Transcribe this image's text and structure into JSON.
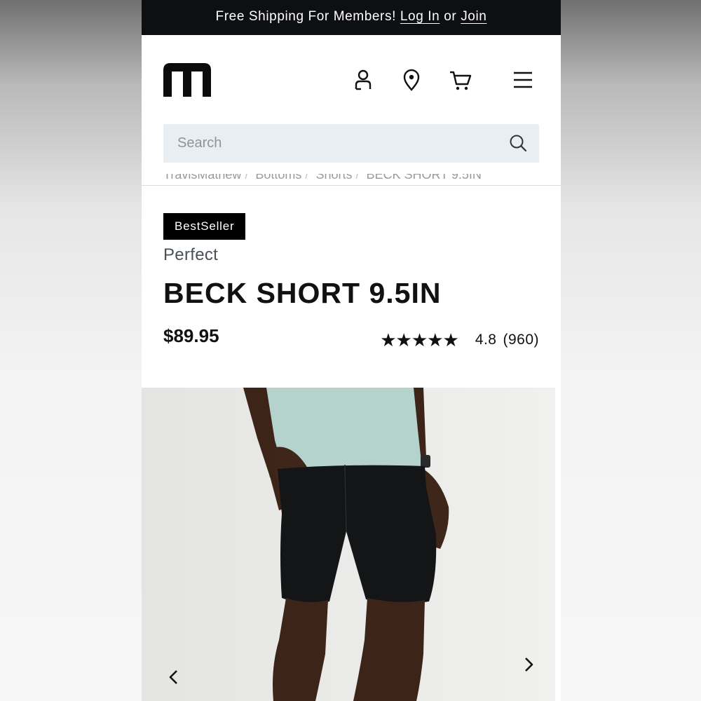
{
  "promo": {
    "text": "Free Shipping For Members!",
    "login_label": "Log In",
    "or_text": "or",
    "join_label": "Join"
  },
  "header": {
    "logo_alt": "brand-logo",
    "icons": [
      "account-icon",
      "location-pin-icon",
      "cart-icon",
      "menu-icon"
    ]
  },
  "search": {
    "placeholder": "Search"
  },
  "breadcrumb": [
    "TravisMathew",
    "Bottoms",
    "Shorts",
    "BECK SHORT 9.5IN"
  ],
  "product": {
    "badge": "BestSeller",
    "fit": "Perfect",
    "name": "BECK SHORT 9.5IN",
    "price": "$89.95",
    "stars": "★★★★★",
    "rating": "4.8",
    "reviews": "(960)"
  },
  "gallery": {
    "prev_icon": "chevron-left-icon",
    "next_icon": "chevron-right-icon"
  },
  "colors": {
    "promo_bg": "#0d0f12",
    "search_bg": "#e9eef2",
    "badge_bg": "#000000",
    "shirt": "#b6d2cc",
    "shorts": "#141516"
  }
}
